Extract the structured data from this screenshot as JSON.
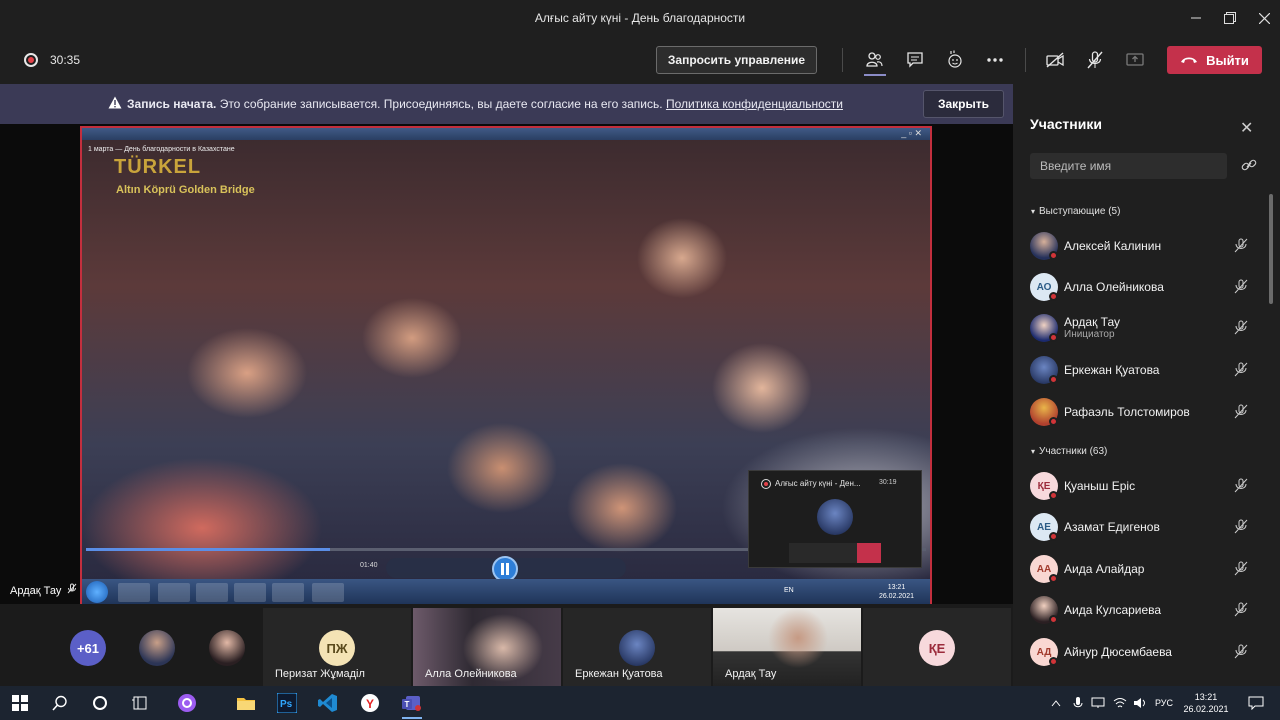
{
  "window": {
    "title": "Алғыс айту күні - День благодарности"
  },
  "toolbar": {
    "timer": "30:35",
    "request_control_label": "Запросить управление",
    "leave_label": "Выйти"
  },
  "banner": {
    "bold_text": "Запись начата.",
    "text": " Это собрание записывается. Присоединяясь, вы даете согласие на его запись. ",
    "link_text": "Политика конфиденциальности",
    "close_label": "Закрыть"
  },
  "shared_screen": {
    "video_caption": "1 марта — День благодарности в Казахстане",
    "logo_text": "TÜRKEL",
    "logo_subtext": "Altın Köprü Golden Bridge",
    "video_time": "01:40",
    "progress": 0.29,
    "inner_lang": "EN",
    "inner_time": "13:21",
    "inner_date": "26.02.2021",
    "mini_window_title": "Алғыс айту күні - Ден...",
    "mini_window_time": "30:19"
  },
  "presenter_name": "Ардақ Тау",
  "strip": {
    "more_count": "+61",
    "tiles": [
      {
        "initials": "ПЖ",
        "name": "Перизат Жұмаділ"
      },
      {
        "name": "Алла Олейникова"
      },
      {
        "name": "Еркежан Қуатова"
      },
      {
        "name": "Ардақ Тау"
      },
      {
        "initials": "ҚЕ"
      }
    ]
  },
  "panel": {
    "title": "Участники",
    "search_placeholder": "Введите имя",
    "presenters_label": "Выступающие (5)",
    "attendees_label": "Участники (63)",
    "presenters": [
      {
        "name": "Алексей Калинин",
        "initials": ""
      },
      {
        "name": "Алла Олейникова",
        "initials": "АО"
      },
      {
        "name": "Ардақ Тау",
        "initials": "",
        "sub": "Инициатор"
      },
      {
        "name": "Еркежан Қуатова",
        "initials": ""
      },
      {
        "name": "Рафаэль Толстомиров",
        "initials": ""
      }
    ],
    "attendees": [
      {
        "name": "Қуаныш Еріс",
        "initials": "ҚЕ"
      },
      {
        "name": "Азамат Едигенов",
        "initials": "АЕ"
      },
      {
        "name": "Аида Алайдар",
        "initials": "АА"
      },
      {
        "name": "Аида Кулсариева",
        "initials": ""
      },
      {
        "name": "Айнур Дюсембаева",
        "initials": "АД"
      }
    ]
  },
  "taskbar": {
    "lang": "РУС",
    "time": "13:21",
    "date": "26.02.2021"
  }
}
